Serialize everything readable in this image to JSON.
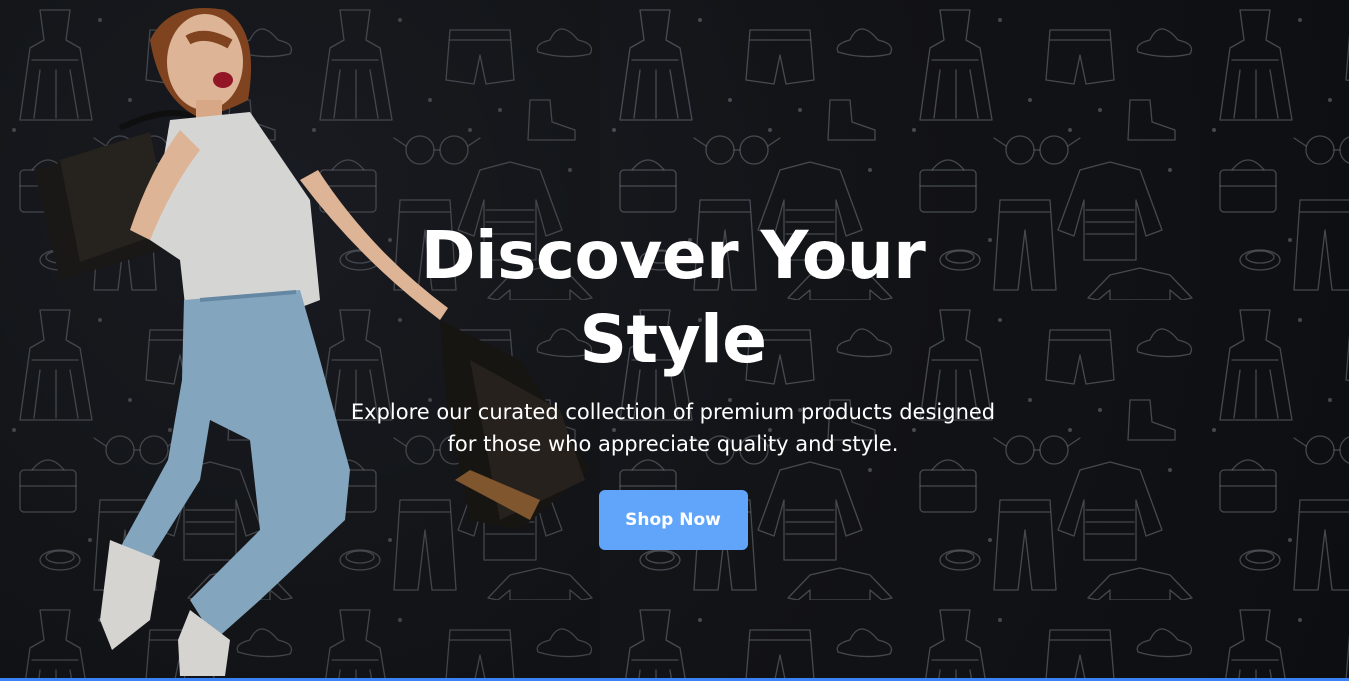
{
  "hero": {
    "title": "Discover Your Style",
    "subtitle": "Explore our curated collection of premium products designed for those who appreciate quality and style.",
    "cta_label": "Shop Now"
  },
  "colors": {
    "background": "#15171c",
    "accent": "#60a5fa",
    "text": "#ffffff",
    "bottom_bar": "#3b82f6"
  },
  "icons": [
    "clothing-pattern-background",
    "model-with-shopping-bags-image"
  ]
}
